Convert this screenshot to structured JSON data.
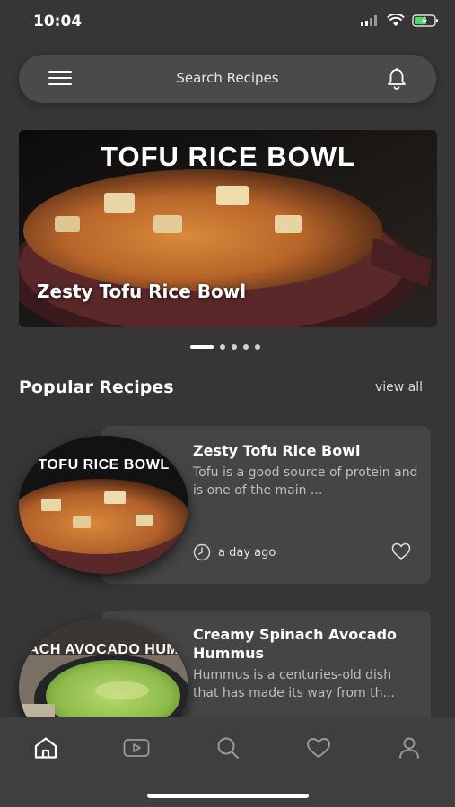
{
  "status_bar": {
    "time": "10:04",
    "icons": [
      "signal-icon",
      "wifi-icon",
      "battery-charging-icon"
    ]
  },
  "search": {
    "placeholder": "Search Recipes",
    "icons": [
      "menu-icon",
      "bell-icon"
    ]
  },
  "hero": {
    "image_title": "TOFU RICE BOWL",
    "caption": "Zesty Tofu Rice Bowl",
    "slides_count": 5,
    "active_slide": 1
  },
  "popular": {
    "title": "Popular Recipes",
    "view_all": "view all",
    "items": [
      {
        "thumb_text": "TOFU RICE BOWL",
        "title": "Zesty Tofu Rice Bowl",
        "description": "Tofu is a good source of protein and is one of the main ...",
        "time": "a day ago"
      },
      {
        "thumb_text": "ACH AVOCADO HUM",
        "title": "Creamy Spinach Avocado Hummus",
        "description": "Hummus is a centuries-old dish that has made its way from th..."
      }
    ]
  },
  "bottom_nav": {
    "items": [
      "home-icon",
      "video-icon",
      "search-icon",
      "heart-icon",
      "profile-icon"
    ],
    "active": "home-icon"
  },
  "colors": {
    "background": "#363636",
    "card": "#454545",
    "nav": "#3f3f3f"
  }
}
